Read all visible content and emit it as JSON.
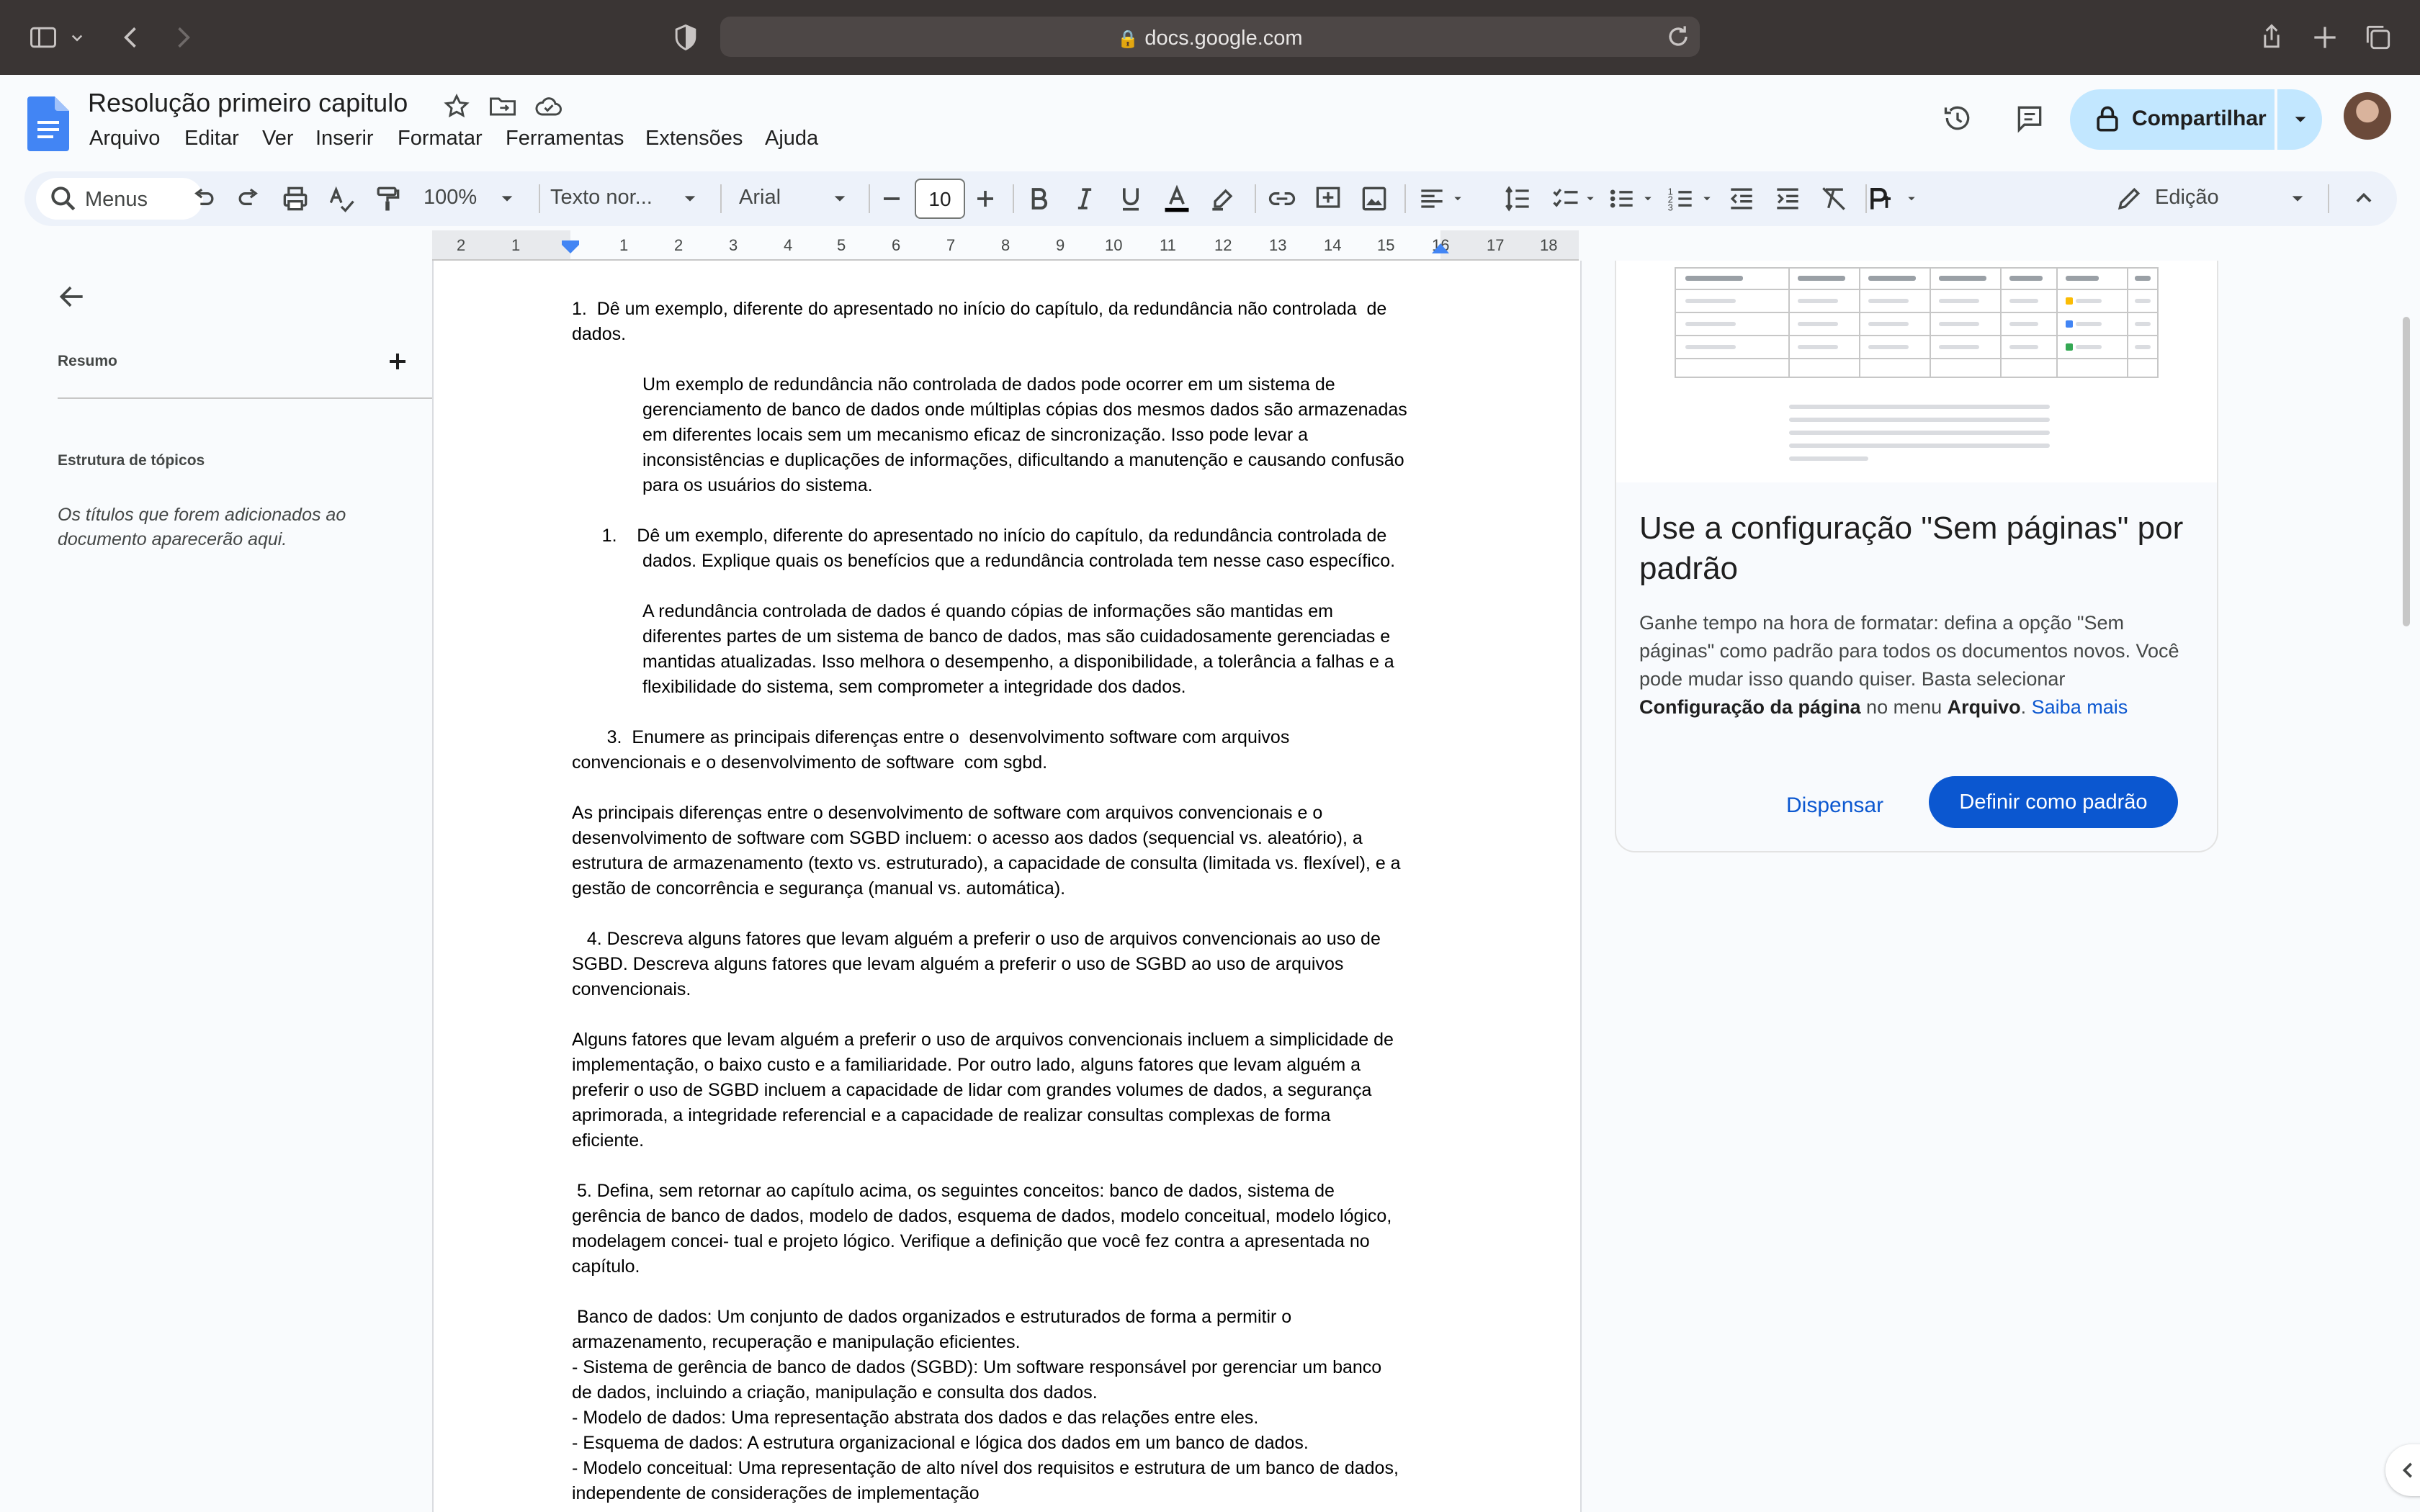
{
  "browser": {
    "url": "docs.google.com"
  },
  "doc": {
    "title": "Resolução primeiro capitulo",
    "menu": [
      "Arquivo",
      "Editar",
      "Ver",
      "Inserir",
      "Formatar",
      "Ferramentas",
      "Extensões",
      "Ajuda"
    ],
    "share_label": "Compartilhar"
  },
  "toolbar": {
    "menus_label": "Menus",
    "zoom": "100%",
    "style": "Texto nor...",
    "font": "Arial",
    "font_size": "10",
    "mode": "Edição"
  },
  "ruler": {
    "labels": [
      "2",
      "1",
      "1",
      "2",
      "3",
      "4",
      "5",
      "6",
      "7",
      "8",
      "9",
      "10",
      "11",
      "12",
      "13",
      "14",
      "15",
      "16",
      "17",
      "18"
    ]
  },
  "outline": {
    "summary_label": "Resumo",
    "structure_label": "Estrutura de tópicos",
    "empty_text": "Os títulos que forem adicionados ao documento aparecerão aqui."
  },
  "content": {
    "lines": [
      {
        "text": "1.  Dê um exemplo, diferente do apresentado no início do capítulo, da redundância não controlada  de",
        "indent": 0
      },
      {
        "text": "dados.",
        "indent": 0
      },
      {
        "text": "",
        "indent": 0
      },
      {
        "text": "Um exemplo de redundância não controlada de dados pode ocorrer em um sistema de",
        "indent": 1
      },
      {
        "text": "gerenciamento de banco de dados onde múltiplas cópias dos mesmos dados são armazenadas",
        "indent": 1
      },
      {
        "text": "em diferentes locais sem um mecanismo eficaz de sincronização. Isso pode levar a",
        "indent": 1
      },
      {
        "text": "inconsistências e duplicações de informações, dificultando a manutenção e causando confusão",
        "indent": 1
      },
      {
        "text": "para os usuários do sistema.",
        "indent": 1
      },
      {
        "text": "",
        "indent": 0
      },
      {
        "text": "      1.    Dê um exemplo, diferente do apresentado no início do capítulo, da redundância controlada de",
        "indent": 0
      },
      {
        "text": "dados. Explique quais os benefícios que a redundância controlada tem nesse caso específico.",
        "indent": 1
      },
      {
        "text": "",
        "indent": 0
      },
      {
        "text": "A redundância controlada de dados é quando cópias de informações são mantidas em",
        "indent": 1
      },
      {
        "text": "diferentes partes de um sistema de banco de dados, mas são cuidadosamente gerenciadas e",
        "indent": 1
      },
      {
        "text": "mantidas atualizadas. Isso melhora o desempenho, a disponibilidade, a tolerância a falhas e a",
        "indent": 1
      },
      {
        "text": "flexibilidade do sistema, sem comprometer a integridade dos dados.",
        "indent": 1
      },
      {
        "text": "",
        "indent": 0
      },
      {
        "text": "       3.  Enumere as principais diferenças entre o  desenvolvimento software com arquivos",
        "indent": 0
      },
      {
        "text": "convencionais e o desenvolvimento de software  com sgbd.",
        "indent": 0
      },
      {
        "text": "",
        "indent": 0
      },
      {
        "text": "As principais diferenças entre o desenvolvimento de software com arquivos convencionais e o",
        "indent": 0
      },
      {
        "text": "desenvolvimento de software com SGBD incluem: o acesso aos dados (sequencial vs. aleatório), a",
        "indent": 0
      },
      {
        "text": "estrutura de armazenamento (texto vs. estruturado), a capacidade de consulta (limitada vs. flexível), e a",
        "indent": 0
      },
      {
        "text": "gestão de concorrência e segurança (manual vs. automática).",
        "indent": 0
      },
      {
        "text": "",
        "indent": 0
      },
      {
        "text": "   4. Descreva alguns fatores que levam alguém a preferir o uso de arquivos convencionais ao uso de",
        "indent": 0
      },
      {
        "text": "SGBD. Descreva alguns fatores que levam alguém a preferir o uso de SGBD ao uso de arquivos",
        "indent": 0
      },
      {
        "text": "convencionais.",
        "indent": 0
      },
      {
        "text": "",
        "indent": 0
      },
      {
        "text": "Alguns fatores que levam alguém a preferir o uso de arquivos convencionais incluem a simplicidade de",
        "indent": 0
      },
      {
        "text": "implementação, o baixo custo e a familiaridade. Por outro lado, alguns fatores que levam alguém a",
        "indent": 0
      },
      {
        "text": "preferir o uso de SGBD incluem a capacidade de lidar com grandes volumes de dados, a segurança",
        "indent": 0
      },
      {
        "text": "aprimorada, a integridade referencial e a capacidade de realizar consultas complexas de forma",
        "indent": 0
      },
      {
        "text": "eficiente.",
        "indent": 0
      },
      {
        "text": "",
        "indent": 0
      },
      {
        "text": " 5. Defina, sem retornar ao capítulo acima, os seguintes conceitos: banco de dados, sistema de",
        "indent": 0
      },
      {
        "text": "gerência de banco de dados, modelo de dados, esquema de dados, modelo conceitual, modelo lógico,",
        "indent": 0
      },
      {
        "text": "modelagem concei- tual e projeto lógico. Verifique a definição que você fez contra a apresentada no",
        "indent": 0
      },
      {
        "text": "capítulo.",
        "indent": 0
      },
      {
        "text": "",
        "indent": 0
      },
      {
        "text": " Banco de dados: Um conjunto de dados organizados e estruturados de forma a permitir o",
        "indent": 0
      },
      {
        "text": "armazenamento, recuperação e manipulação eficientes.",
        "indent": 0
      },
      {
        "text": "- Sistema de gerência de banco de dados (SGBD): Um software responsável por gerenciar um banco",
        "indent": 0
      },
      {
        "text": "de dados, incluindo a criação, manipulação e consulta dos dados.",
        "indent": 0
      },
      {
        "text": "- Modelo de dados: Uma representação abstrata dos dados e das relações entre eles.",
        "indent": 0
      },
      {
        "text": "- Esquema de dados: A estrutura organizacional e lógica dos dados em um banco de dados.",
        "indent": 0
      },
      {
        "text": "- Modelo conceitual: Uma representação de alto nível dos requisitos e estrutura de um banco de dados,",
        "indent": 0
      },
      {
        "text": "independente de considerações de implementação",
        "indent": 0
      }
    ]
  },
  "side_card": {
    "title": "Use a configuração \"Sem páginas\" por padrão",
    "body_pre": "Ganhe tempo na hora de formatar: defina a opção \"Sem páginas\" como padrão para todos os documentos novos. Você pode mudar isso quando quiser. Basta selecionar ",
    "body_bold1": "Configuração da página",
    "body_mid": " no menu ",
    "body_bold2": "Arquivo",
    "body_end": ". ",
    "link": "Saiba mais",
    "dismiss": "Dispensar",
    "set_default": "Definir como padrão"
  }
}
